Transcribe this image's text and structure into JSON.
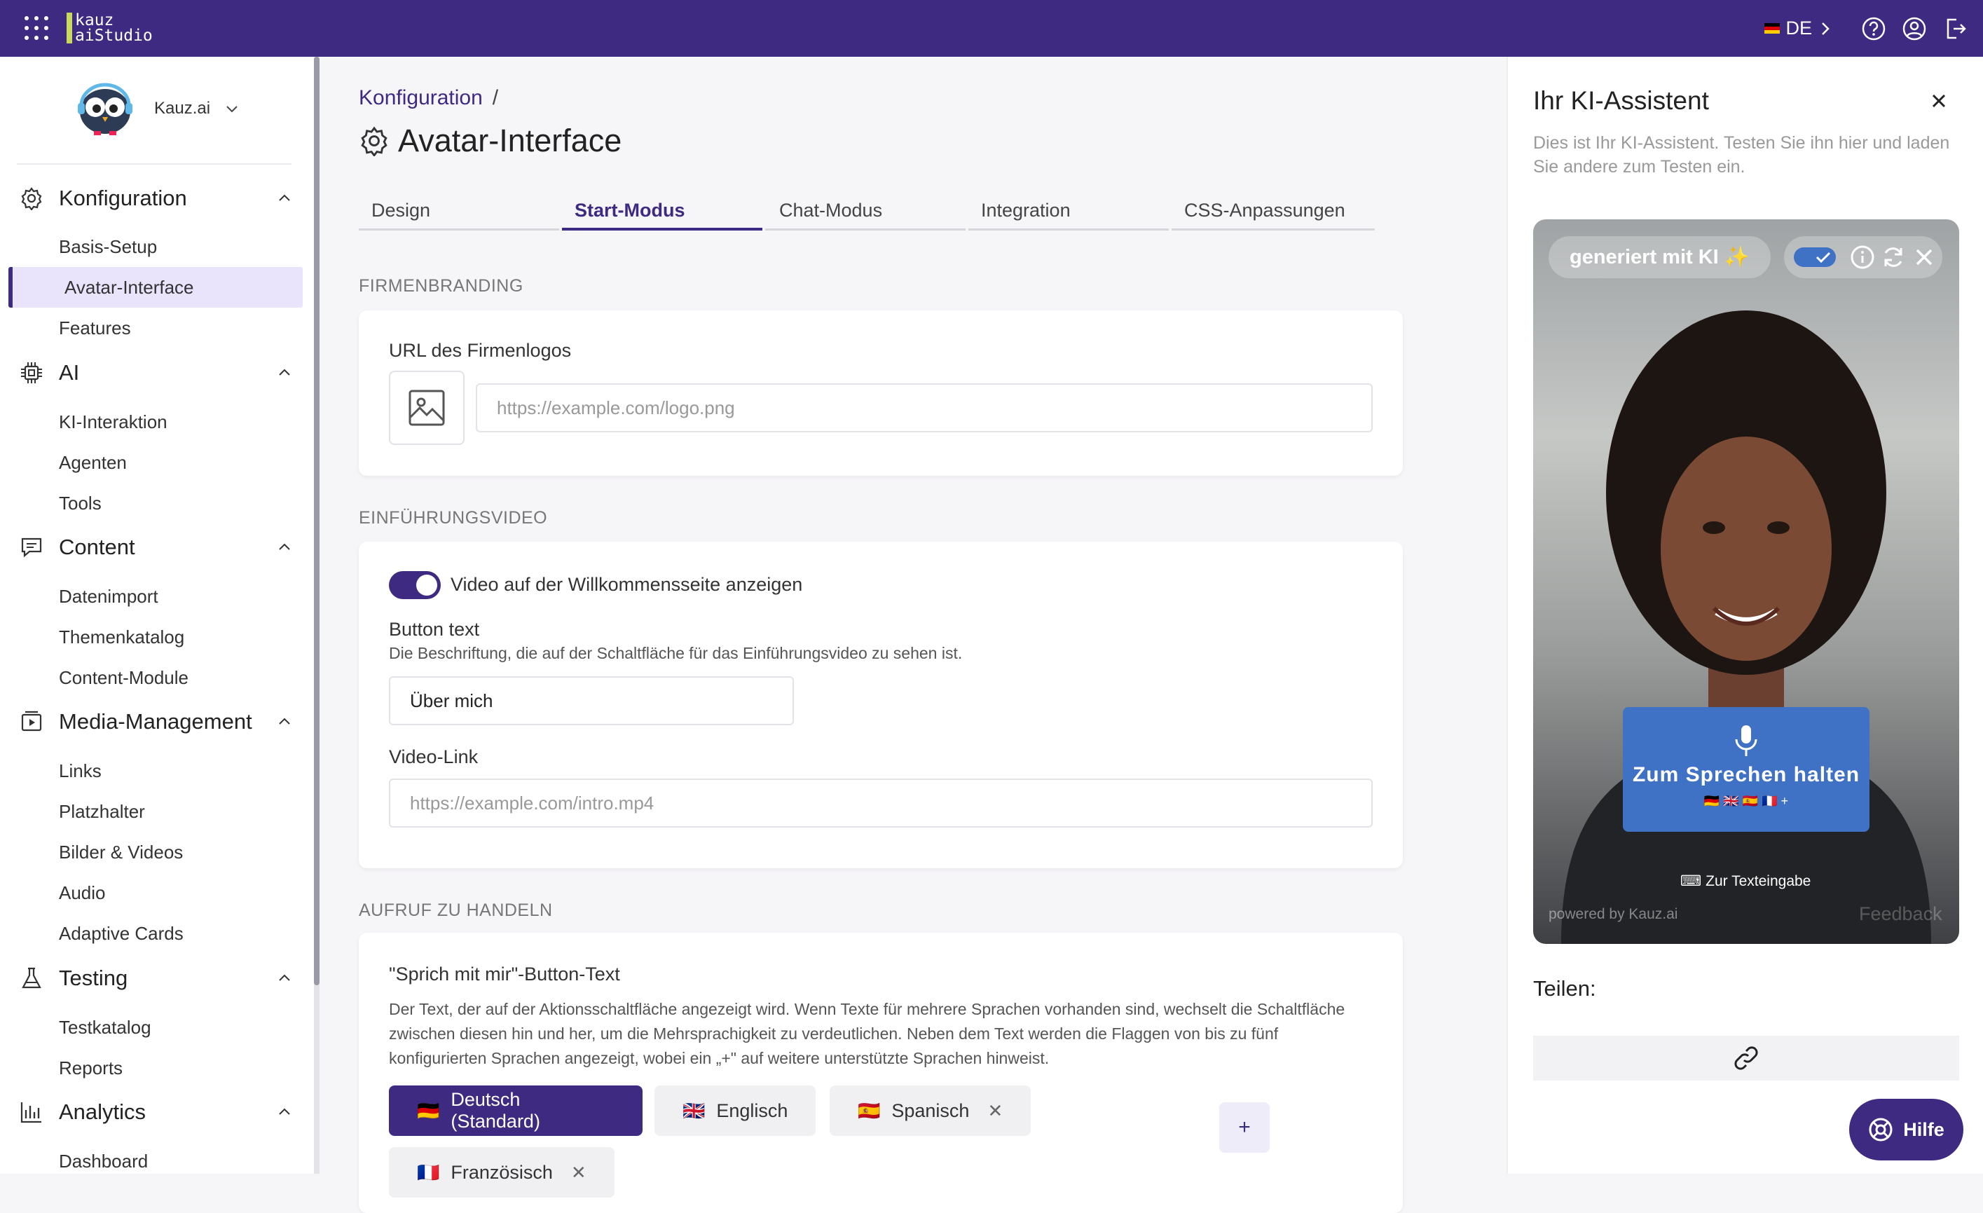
{
  "topbar": {
    "logo_line1": "kauz",
    "logo_line2": "aiStudio",
    "language": "DE"
  },
  "sidebar": {
    "org_name": "Kauz.ai",
    "sections": [
      {
        "title": "Konfiguration",
        "items": [
          "Basis-Setup",
          "Avatar-Interface",
          "Features"
        ]
      },
      {
        "title": "AI",
        "items": [
          "KI-Interaktion",
          "Agenten",
          "Tools"
        ]
      },
      {
        "title": "Content",
        "items": [
          "Datenimport",
          "Themenkatalog",
          "Content-Module"
        ]
      },
      {
        "title": "Media-Management",
        "items": [
          "Links",
          "Platzhalter",
          "Bilder & Videos",
          "Audio",
          "Adaptive Cards"
        ]
      },
      {
        "title": "Testing",
        "items": [
          "Testkatalog",
          "Reports"
        ]
      },
      {
        "title": "Analytics",
        "items": [
          "Dashboard"
        ]
      }
    ],
    "active_item": "Avatar-Interface"
  },
  "main": {
    "breadcrumb": "Konfiguration",
    "breadcrumb_sep": "/",
    "title": "Avatar-Interface",
    "tabs": [
      "Design",
      "Start-Modus",
      "Chat-Modus",
      "Integration",
      "CSS-Anpassungen"
    ],
    "active_tab": "Start-Modus",
    "branding": {
      "section": "FIRMENBRANDING",
      "logo_label": "URL des Firmenlogos",
      "logo_placeholder": "https://example.com/logo.png"
    },
    "video": {
      "section": "EINFÜHRUNGSVIDEO",
      "toggle_label": "Video auf der Willkommensseite anzeigen",
      "toggle_on": true,
      "button_text_label": "Button text",
      "button_text_desc": "Die Beschriftung, die auf der Schaltfläche für das Einführungsvideo zu sehen ist.",
      "button_text_value": "Über mich",
      "video_link_label": "Video-Link",
      "video_link_placeholder": "https://example.com/intro.mp4"
    },
    "cta": {
      "section": "AUFRUF ZU HANDELN",
      "label": "\"Sprich mit mir\"-Button-Text",
      "desc": "Der Text, der auf der Aktionsschaltfläche angezeigt wird. Wenn Texte für mehrere Sprachen vorhanden sind, wechselt die Schaltfläche zwischen diesen hin und her, um die Mehrsprachigkeit zu verdeutlichen. Neben dem Text werden die Flaggen von bis zu fünf konfigurierten Sprachen angezeigt, wobei ein „+\" auf weitere unterstützte Sprachen hinweist.",
      "languages": [
        {
          "flag": "🇩🇪",
          "name": "Deutsch (Standard)"
        },
        {
          "flag": "🇬🇧",
          "name": "Englisch"
        },
        {
          "flag": "🇪🇸",
          "name": "Spanisch"
        },
        {
          "flag": "🇫🇷",
          "name": "Französisch"
        }
      ],
      "remove_symbol": "✕",
      "add_symbol": "+"
    }
  },
  "assistant": {
    "title": "Ihr KI-Assistent",
    "desc": "Dies ist Ihr KI-Assistent. Testen Sie ihn hier und laden Sie andere zum Testen ein.",
    "badge": "generiert mit KI ✨",
    "speak_label": "Zum Sprechen halten",
    "speak_flags": "🇩🇪 🇬🇧 🇪🇸 🇫🇷 +",
    "text_input": "⌨ Zur Texteingabe",
    "powered": "powered by Kauz.ai",
    "feedback": "Feedback",
    "share_label": "Teilen:"
  },
  "help_button": "Hilfe",
  "colors": {
    "brand": "#3e2a80",
    "active_bg": "#e9e4fb",
    "speak_button": "#3f72c4"
  }
}
